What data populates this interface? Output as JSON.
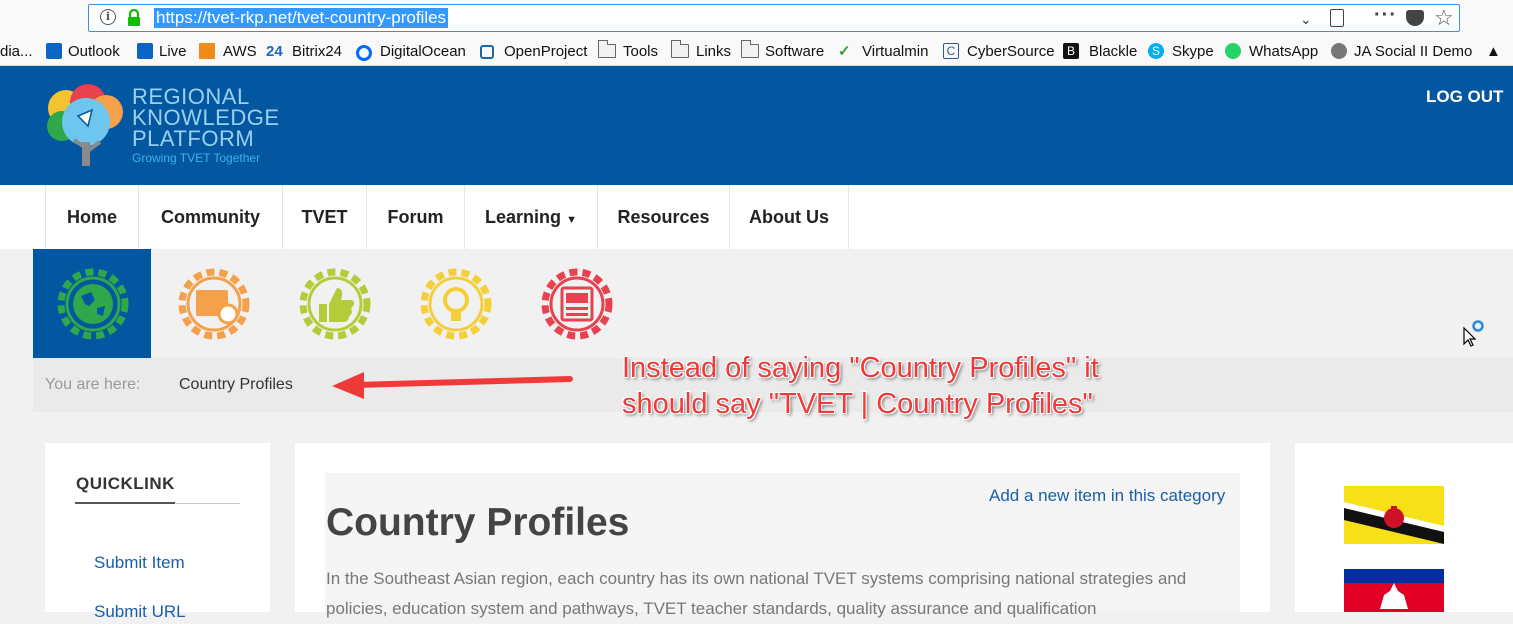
{
  "browser": {
    "url": "https://tvet-rkp.net/tvet-country-profiles"
  },
  "bookmarks": [
    {
      "label": "dia...",
      "icon": "bookmark-icon"
    },
    {
      "label": "Outlook",
      "icon": "outlook-icon",
      "color": "#0a64c8"
    },
    {
      "label": "Live",
      "icon": "outlook-live-icon",
      "color": "#0a64c8"
    },
    {
      "label": "AWS",
      "icon": "aws-cube-icon",
      "color": "#f08a1c"
    },
    {
      "label": "Bitrix24",
      "icon": "bitrix24-icon",
      "color": "#1f66c1"
    },
    {
      "label": "DigitalOcean",
      "icon": "digitalocean-icon",
      "color": "#0069ff"
    },
    {
      "label": "OpenProject",
      "icon": "openproject-icon",
      "color": "#1a67a3"
    },
    {
      "label": "Tools",
      "icon": "folder-icon"
    },
    {
      "label": "Links",
      "icon": "folder-icon"
    },
    {
      "label": "Software",
      "icon": "folder-icon"
    },
    {
      "label": "Virtualmin",
      "icon": "virtualmin-icon",
      "color": "#3a9b3a"
    },
    {
      "label": "CyberSource",
      "icon": "cybersource-icon",
      "color": "#2b5b9a"
    },
    {
      "label": "Blackle",
      "icon": "blackle-icon",
      "color": "#111111"
    },
    {
      "label": "Skype",
      "icon": "skype-icon",
      "color": "#00aff0"
    },
    {
      "label": "WhatsApp",
      "icon": "whatsapp-icon",
      "color": "#25d366"
    },
    {
      "label": "JA Social II Demo",
      "icon": "globe-icon",
      "color": "#666666"
    }
  ],
  "header": {
    "logo_line1": "REGIONAL",
    "logo_line2": "KNOWLEDGE",
    "logo_line3": "PLATFORM",
    "logo_tagline": "Growing TVET Together",
    "logout_label": "LOG OUT",
    "bg_color": "#0357a0"
  },
  "nav": {
    "items": [
      {
        "label": "Home"
      },
      {
        "label": "Community"
      },
      {
        "label": "TVET"
      },
      {
        "label": "Forum"
      },
      {
        "label": "Learning"
      },
      {
        "label": "Resources"
      },
      {
        "label": "About Us"
      }
    ]
  },
  "category_icons": [
    {
      "icon": "globe-gear-icon",
      "color": "#2ea84a",
      "active": true
    },
    {
      "icon": "calendar-gear-icon",
      "color": "#f5a04a"
    },
    {
      "icon": "thumbs-up-gear-icon",
      "color": "#b5cc3a"
    },
    {
      "icon": "lightbulb-gear-icon",
      "color": "#f5cf3a"
    },
    {
      "icon": "document-gear-icon",
      "color": "#e8414f"
    }
  ],
  "breadcrumb": {
    "label": "You are here:",
    "current": "Country Profiles"
  },
  "annotation": {
    "line1": "Instead of saying \"Country Profiles\" it",
    "line2": "should say \"TVET | Country Profiles\"",
    "color": "#f03a3a"
  },
  "quicklink": {
    "title": "QUICKLINK",
    "links": [
      "Submit Item",
      "Submit URL"
    ]
  },
  "main": {
    "add_item_label": "Add a new item in this category",
    "title": "Country Profiles",
    "intro": "In the Southeast Asian region, each country has its own national TVET systems comprising national strategies and policies, education system and pathways, TVET teacher standards, quality assurance and qualification"
  },
  "flags": [
    {
      "name": "brunei-flag",
      "color": "#f7e017"
    },
    {
      "name": "cambodia-flag",
      "color": "#032ea1"
    }
  ]
}
